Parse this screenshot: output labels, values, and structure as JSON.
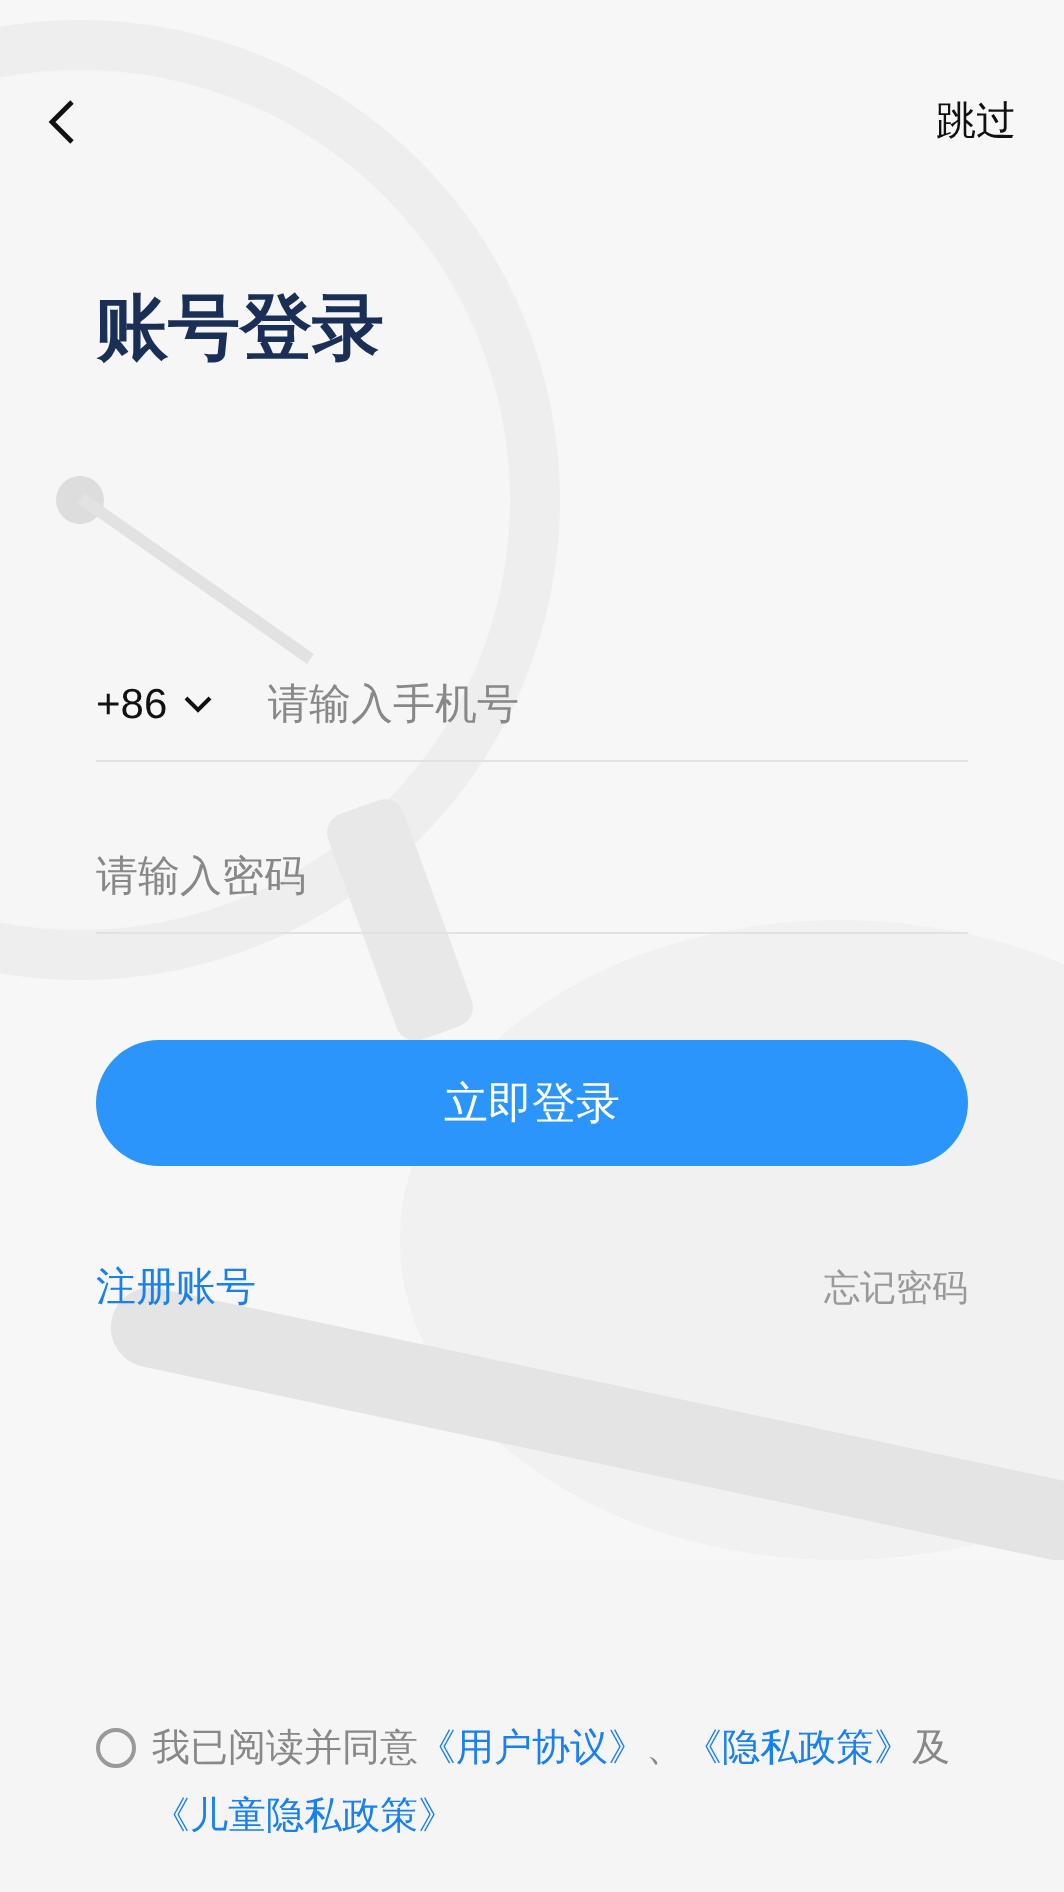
{
  "top_bar": {
    "skip": "跳过"
  },
  "title": "账号登录",
  "phone": {
    "country_code": "+86",
    "placeholder": "请输入手机号"
  },
  "password": {
    "placeholder": "请输入密码"
  },
  "login_button": "立即登录",
  "register_link": "注册账号",
  "forgot_link": "忘记密码",
  "agreement": {
    "checked": false,
    "parts": [
      {
        "kind": "text",
        "text": "我已阅读并同意"
      },
      {
        "kind": "link",
        "text": "《用户协议》"
      },
      {
        "kind": "text",
        "text": "、"
      },
      {
        "kind": "link",
        "text": "《隐私政策》"
      },
      {
        "kind": "text",
        "text": "及"
      },
      {
        "kind": "link",
        "text": "《儿童隐私政策》"
      }
    ]
  }
}
